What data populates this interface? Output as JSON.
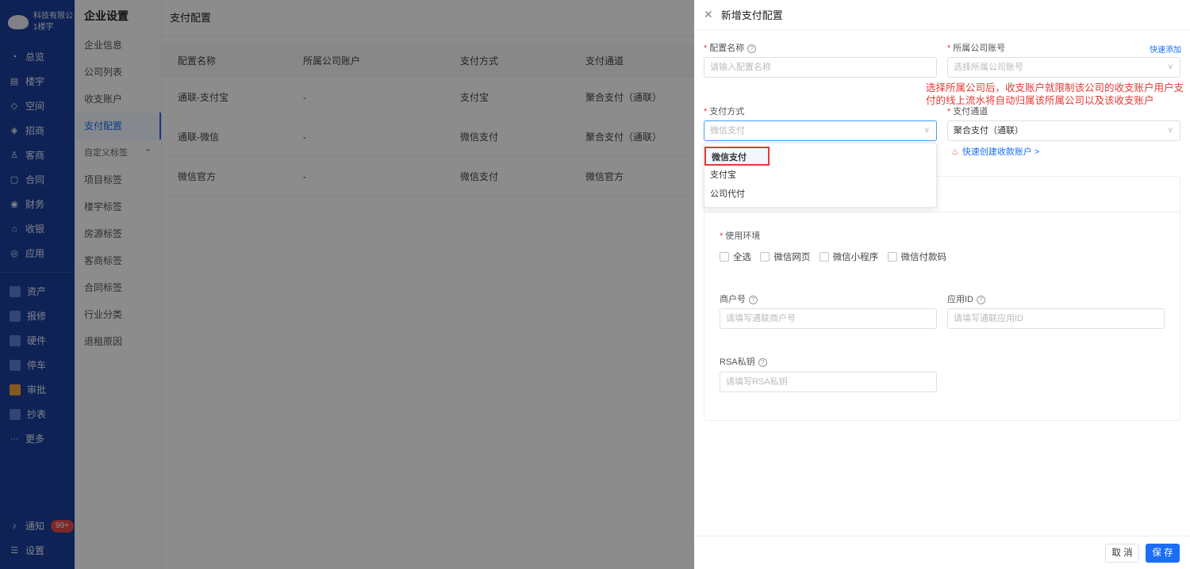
{
  "nav": {
    "company": "科技有限公",
    "building": "1楼宇",
    "items": [
      "总览",
      "楼宇",
      "空间",
      "招商",
      "客商",
      "合同",
      "财务",
      "收银",
      "应用"
    ],
    "items2": [
      "资产",
      "报修",
      "硬件",
      "停车",
      "审批",
      "抄表",
      "更多"
    ],
    "notify": "通知",
    "badge": "99+",
    "settings": "设置"
  },
  "submenu": {
    "title": "企业设置",
    "items": [
      "企业信息",
      "公司列表",
      "收支账户",
      "支付配置"
    ],
    "group": "自定义标签",
    "group_items": [
      "项目标签",
      "楼宇标签",
      "房源标签",
      "客商标签",
      "合同标签",
      "行业分类",
      "退租原因"
    ]
  },
  "main": {
    "breadcrumb": "支付配置",
    "headers": [
      "配置名称",
      "所属公司账户",
      "支付方式",
      "支付通道"
    ],
    "rows": [
      [
        "通联-支付宝",
        "-",
        "支付宝",
        "聚合支付（通联）"
      ],
      [
        "通联-微信",
        "-",
        "微信支付",
        "聚合支付（通联）"
      ],
      [
        "微信官方",
        "-",
        "微信支付",
        "微信官方"
      ]
    ]
  },
  "drawer": {
    "title": "新增支付配置",
    "config_name_label": "配置名称",
    "config_name_placeholder": "请输入配置名称",
    "company_label": "所属公司账号",
    "quick_add": "快速添加",
    "company_placeholder": "选择所属公司账号",
    "note": "选择所属公司后，收支账户就限制该公司的收支账户用户支付的线上流水将自动归属该所属公司以及该收支账户",
    "pay_method_label": "支付方式",
    "pay_method_value": "微信支付",
    "channel_label": "支付通道",
    "channel_value": "聚合支付（通联）",
    "quick_create": "快速创建收款账户 >",
    "options": [
      "微信支付",
      "支付宝",
      "公司代付"
    ],
    "env_label": "使用环境",
    "env_options": [
      "全选",
      "微信网页",
      "微信小程序",
      "微信付款码"
    ],
    "merchant_label": "商户号",
    "merchant_placeholder": "请填写通联商户号",
    "appid_label": "应用ID",
    "appid_placeholder": "请填写通联应用ID",
    "rsa_label": "RSA私钥",
    "rsa_placeholder": "请填写RSA私钥",
    "cancel": "取 消",
    "save": "保 存"
  }
}
